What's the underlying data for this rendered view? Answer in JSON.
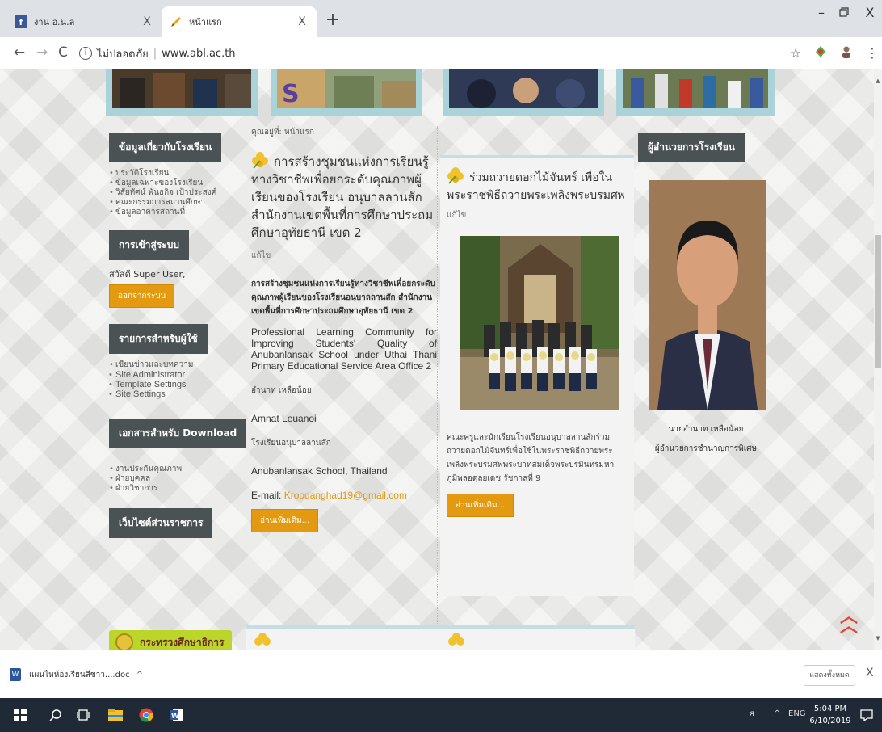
{
  "browser": {
    "tabs": [
      {
        "title": "งาน อ.น.ล",
        "active": false,
        "favicon": "facebook-icon",
        "favicon_color": "#3b5998"
      },
      {
        "title": "หน้าแรก",
        "active": true,
        "favicon": "pencil-icon",
        "favicon_color": "#f0a31d"
      }
    ],
    "close_glyph": "X",
    "new_tab_glyph": "+",
    "window_controls": {
      "minimize": "–",
      "restore": "ⓓ",
      "close": "X"
    },
    "address": {
      "security": "ไม่ปลอดภัย",
      "url": "www.abl.ac.th"
    }
  },
  "sidebar": {
    "about": {
      "title": "ข้อมูลเกี่ยวกับโรงเรียน",
      "items": [
        "ประวัติโรงเรียน",
        "ข้อมูลเฉพาะของโรงเรียน",
        "วิสัยทัศน์ พันธกิจ เป้าประสงค์",
        "คณะกรรมการสถานศึกษา",
        "ข้อมูลอาคารสถานที่"
      ]
    },
    "login": {
      "title": "การเข้าสู่ระบบ",
      "greeting": "สวัสดี Super User,",
      "logout_label": "ออกจากระบบ"
    },
    "user_menu": {
      "title": "รายการสำหรับผู้ใช้",
      "items": [
        "เขียนข่าวและบทความ",
        "Site Administrator",
        "Template Settings",
        "Site Settings"
      ]
    },
    "downloads": {
      "title": "เอกสารสำหรับ Download",
      "items": [
        "งานประกันคุณภาพ",
        "ฝ่ายบุคคล",
        "ฝ่ายวิชาการ"
      ]
    },
    "gov_sites": {
      "title": "เว็บไซต์ส่วนราชการ"
    },
    "ministry_label": "กระทรวงศึกษาธิการ"
  },
  "main_article": {
    "breadcrumb": "คุณอยู่ที่: หน้าแรก",
    "title": "การสร้างชุมชนแห่งการเรียนรู้ทางวิชาชีพเพื่อยกระดับคุณภาพผู้เรียนของโรงเรียน อนุบาลลานสัก สำนักงานเขตพื้นที่การศึกษาประถมศึกษาอุทัยธานี เขต 2",
    "edit": "แก้ไข",
    "thai_title": "การสร้างชุมชนแห่งการเรียนรู้ทางวิชาชีพเพื่อยกระดับคุณภาพผู้เรียนของโรงเรียนอนุบาลลานสัก สำนักงานเขตพื้นที่การศึกษาประถมศึกษาอุทัยธานี เขต 2",
    "english_title": "Professional Learning Community for Improving Students' Quality of Anubanlansak School under Uthai Thani Primary Educational Service Area Office 2",
    "author_th": "อำนาท เหลือน้อย",
    "author_en": "Amnat Leuanoi",
    "school_th": "โรงเรียนอนุบาลลานสัก",
    "school_en": "Anubanlansak School, Thailand",
    "email_label": "E-mail:",
    "email": "Kroodanghad19@gmail.com",
    "read_more": "อ่านเพิ่มเติม..."
  },
  "side_article": {
    "title": "ร่วมถวายดอกไม้จันทร์ เพื่อในพระราชพิธีถวายพระเพลิงพระบรมศพ",
    "edit": "แก้ไข",
    "caption": "คณะครูและนักเรียนโรงเรียนอนุบาลลานสักร่วมถวายดอกไม้จันทร์เพื่อใช้ในพระราชพิธีถวายพระเพลิงพระบรมศพพระบาทสมเด็จพระปรมินทรมหาภูมิพลอดุลยเดช รัชกาลที่ 9",
    "read_more": "อ่านเพิ่มเติม..."
  },
  "director": {
    "title": "ผู้อำนวยการโรงเรียน",
    "name": "นายอำนาท เหลือน้อย",
    "position": "ผู้อำนวยการชำนาญการพิเศษ"
  },
  "download_bar": {
    "file": "แผนไหห้องเรียนสีขาว....doc",
    "show_all": "แสดงทั้งหมด",
    "close": "X"
  },
  "taskbar": {
    "tray_lang": "ENG",
    "time": "5:04 PM",
    "date": "6/10/2019"
  },
  "colors": {
    "module_bg": "#4b5254",
    "accent_orange": "#e39a10",
    "banner_frame": "#a9d3d8",
    "ministry_green": "#bcd52b",
    "scroll_top_red": "#e8432f"
  }
}
